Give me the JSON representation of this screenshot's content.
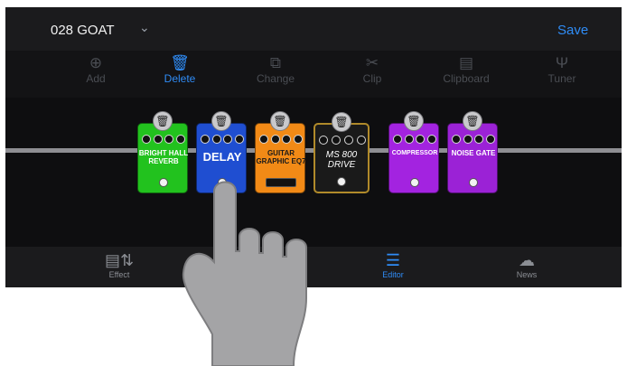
{
  "topbar": {
    "preset_name": "028 GOAT",
    "save_label": "Save"
  },
  "toolbar": {
    "add": "Add",
    "delete": "Delete",
    "change": "Change",
    "clip": "Clip",
    "clipboard": "Clipboard",
    "tuner": "Tuner"
  },
  "pedals": [
    {
      "name": "BRIGHT HALL REVERB",
      "color": "#22c21e",
      "delete_icon": "trash-icon"
    },
    {
      "name": "DELAY",
      "color": "#1f4ed1",
      "delete_icon": "trash-icon"
    },
    {
      "name": "GUITAR GRAPHIC EQ7",
      "color": "#f28a16",
      "delete_icon": "trash-icon"
    },
    {
      "name": "MS 800 DRIVE",
      "color": "#1a1a1a",
      "delete_icon": "trash-icon"
    },
    {
      "name": "COMPRESSOR",
      "color": "#a323e0",
      "delete_icon": "trash-icon"
    },
    {
      "name": "NOISE GATE",
      "color": "#9b22d6",
      "delete_icon": "trash-icon"
    }
  ],
  "tabbar": {
    "effect": "Effect",
    "editor": "Editor",
    "news": "News"
  },
  "colors": {
    "accent": "#2f8cf6",
    "background": "#0e0e10",
    "bar": "#1b1b1d",
    "cable": "#8e8e93",
    "hand": "#a4a4a6"
  }
}
